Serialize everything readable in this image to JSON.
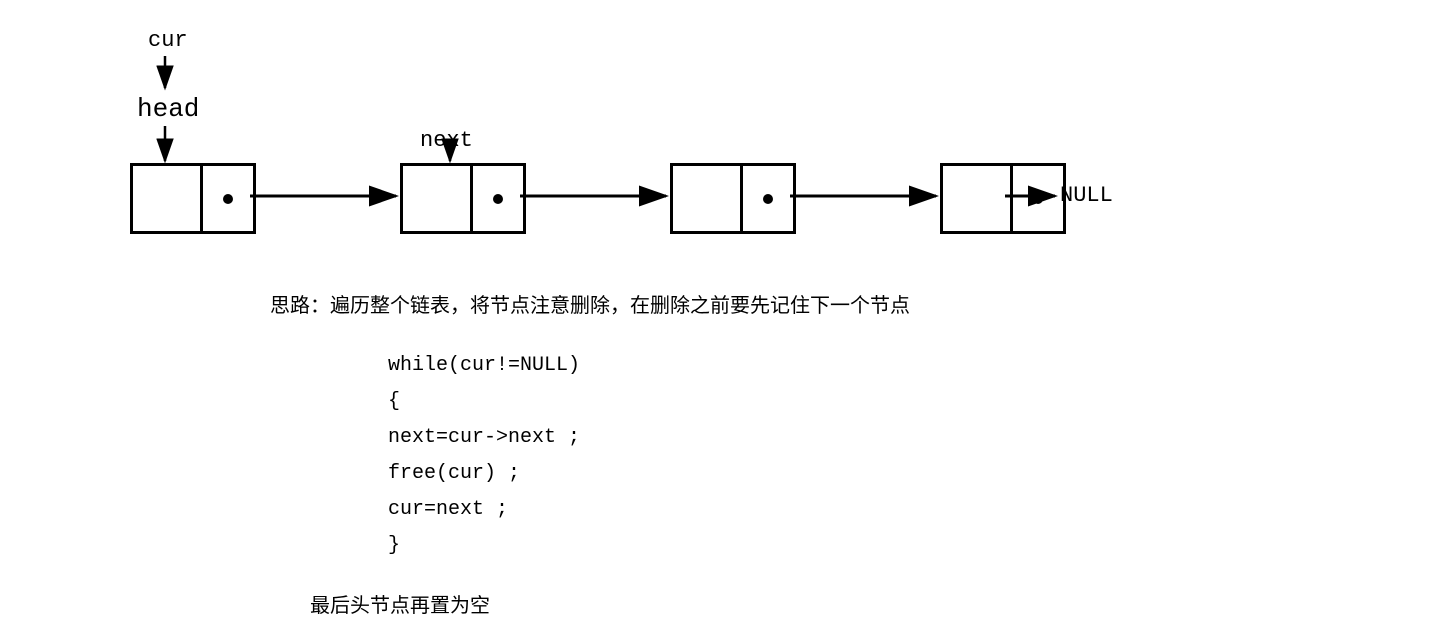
{
  "labels": {
    "cur": "cur",
    "head": "head",
    "next": "next",
    "null": "NULL"
  },
  "text": {
    "thought": "思路：遍历整个链表，将节点注意删除，在删除之前要先记住下一个节点",
    "footer": "最后头节点再置为空"
  },
  "code": {
    "line1": "while(cur!=NULL)",
    "line2": "{",
    "line3": "    next=cur->next ;",
    "line4": "    free(cur) ;",
    "line5": "    cur=next  ;",
    "line6": "}"
  }
}
